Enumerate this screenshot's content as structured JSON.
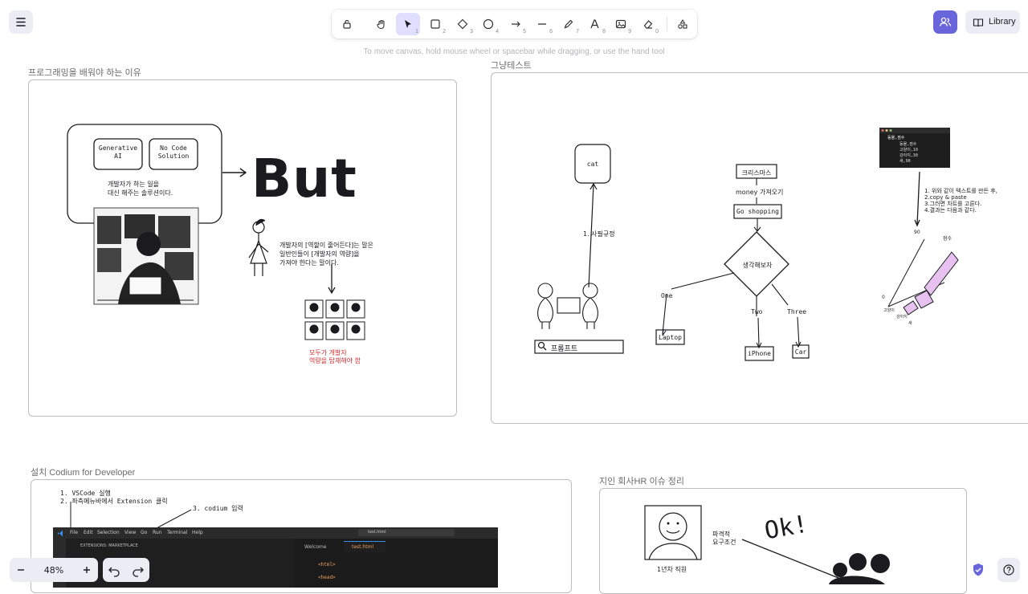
{
  "toolbar": {
    "tools": [
      {
        "name": "lock",
        "key": ""
      },
      {
        "name": "hand",
        "key": ""
      },
      {
        "name": "selection",
        "key": "1"
      },
      {
        "name": "rectangle",
        "key": "2"
      },
      {
        "name": "diamond",
        "key": "3"
      },
      {
        "name": "ellipse",
        "key": "4"
      },
      {
        "name": "arrow",
        "key": "5"
      },
      {
        "name": "line",
        "key": "6"
      },
      {
        "name": "draw",
        "key": "7"
      },
      {
        "name": "text",
        "key": "8"
      },
      {
        "name": "image",
        "key": "9"
      },
      {
        "name": "eraser",
        "key": "0"
      },
      {
        "name": "more-tools",
        "key": ""
      }
    ],
    "active_tool": "selection",
    "hint": "To move canvas, hold mouse wheel or spacebar while dragging, or use the hand tool"
  },
  "top_right": {
    "library_label": "Library"
  },
  "zoom": {
    "value": "48%"
  },
  "colors": {
    "accent": "#6965db",
    "active_tool_bg": "#e0dfff",
    "panel_bg": "#ececf4",
    "warning_text": "#d32f2f"
  },
  "frames": {
    "frame1": {
      "title": "프로그래밍을 배워야 하는 이유",
      "box_generative": "Generative AI",
      "box_nocode": "No Code Solution",
      "caption1": "개발자가 하는 일을",
      "caption2": "대신 해주는 솔루션이다.",
      "but": "But",
      "note1": "개발자의 [역할이 줄어든다]는 말은",
      "note2": "일반인들이 [개발자의 역량]을",
      "note3": "가져야 한다는 말이다.",
      "red1": "모두가 개발자",
      "red2": "역량을 탑재해야 함"
    },
    "frame2": {
      "title": "그냥테스트",
      "cat": "cat",
      "arrow_label": "1. 사필규정",
      "search_text": "프롬프트",
      "christmas": "크리스마스",
      "money": "money 가져오기",
      "shopping": "Go shopping",
      "decide": "생각해보자",
      "one": "One",
      "two": "Two",
      "three": "Three",
      "laptop": "Laptop",
      "iphone": "iPhone",
      "car": "Car",
      "code_header": "동물,점수",
      "code_lines": [
        "동물,점수",
        "고양이,10",
        "강아지,30",
        "새,90"
      ],
      "steps": [
        "1. 위와 같이 텍스트를 만든 후,",
        "2.copy & paste",
        "3.그러면 차트를 고른다.",
        "4.결과는 다음과 같다."
      ],
      "chart_top": "90",
      "chart_zero": "0",
      "chart_series": "점수",
      "chart_cats": [
        "고양이",
        "강아지",
        "새"
      ]
    },
    "frame3": {
      "title": "설치 Codium for Developer",
      "step1": "1. VSCode 실행",
      "step2": "2. 좌측메뉴바에서 Extension 클릭",
      "step3": "3. codium 입력",
      "menu": [
        "File",
        "Edit",
        "Selection",
        "View",
        "Go",
        "Run",
        "Terminal",
        "Help"
      ],
      "tab_welcome": "Welcome",
      "tab_test": "test.html",
      "panel_title": "EXTENSIONS: MARKETPLACE",
      "search_box": "test.html",
      "code1": "<html>",
      "code2": "<head>"
    },
    "frame4": {
      "title": "지인 회사HR 이슈 정리",
      "person": "1년차 직원",
      "cond1": "파격적",
      "cond2": "요구조건",
      "ok": "Ok!"
    }
  }
}
